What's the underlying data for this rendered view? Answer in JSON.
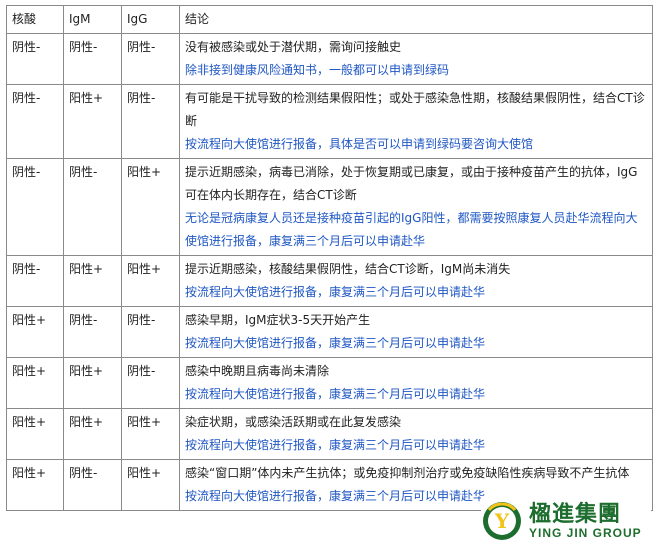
{
  "table": {
    "headers": [
      "核酸",
      "IgM",
      "IgG",
      "结论"
    ],
    "rows": [
      {
        "nucleic": "阴性-",
        "igm": "阴性-",
        "igg": "阴性-",
        "conclusion": "没有被感染或处于潜伏期，需询问接触史",
        "note": "除非接到健康风险通知书，一般都可以申请到绿码"
      },
      {
        "nucleic": "阴性-",
        "igm": "阳性+",
        "igg": "阴性-",
        "conclusion": "有可能是干扰导致的检测结果假阳性；或处于感染急性期，核酸结果假阴性，结合CT诊断",
        "note": "按流程向大使馆进行报备，具体是否可以申请到绿码要咨询大使馆"
      },
      {
        "nucleic": "阴性-",
        "igm": "阴性-",
        "igg": "阳性+",
        "conclusion": "提示近期感染，病毒已消除，处于恢复期或已康复，或由于接种疫苗产生的抗体，IgG可在体内长期存在，结合CT诊断",
        "note": "无论是冠病康复人员还是接种疫苗引起的IgG阳性，都需要按照康复人员赴华流程向大使馆进行报备，康复满三个月后可以申请赴华"
      },
      {
        "nucleic": "阴性-",
        "igm": "阳性+",
        "igg": "阳性+",
        "conclusion": "提示近期感染，核酸结果假阴性，结合CT诊断，IgM尚未消失",
        "note": "按流程向大使馆进行报备，康复满三个月后可以申请赴华"
      },
      {
        "nucleic": "阳性+",
        "igm": "阴性-",
        "igg": "阴性-",
        "conclusion": "感染早期，IgM症状3-5天开始产生",
        "note": "按流程向大使馆进行报备，康复满三个月后可以申请赴华"
      },
      {
        "nucleic": "阳性+",
        "igm": "阳性+",
        "igg": "阴性-",
        "conclusion": "感染中晚期且病毒尚未清除",
        "note": "按流程向大使馆进行报备，康复满三个月后可以申请赴华"
      },
      {
        "nucleic": "阳性+",
        "igm": "阳性+",
        "igg": "阳性+",
        "conclusion": "染症状期，或感染活跃期或在此复发感染",
        "note": "按流程向大使馆进行报备，康复满三个月后可以申请赴华"
      },
      {
        "nucleic": "阳性+",
        "igm": "阴性-",
        "igg": "阳性+",
        "conclusion": "感染“窗口期”体内未产生抗体；或免疫抑制剂治疗或免疫缺陷性疾病导致不产生抗体",
        "note": "按流程向大使馆进行报备，康复满三个月后可以申请赴华"
      }
    ]
  },
  "logo": {
    "name_cn": "楹進集團",
    "name_en": "YING JIN GROUP",
    "mark_letter": "Y",
    "colors": {
      "green": "#1d6e2e",
      "yellow": "#f2c318"
    }
  },
  "colors": {
    "note": "#1f57c3",
    "text": "#222222",
    "border": "#8a8a8a"
  }
}
